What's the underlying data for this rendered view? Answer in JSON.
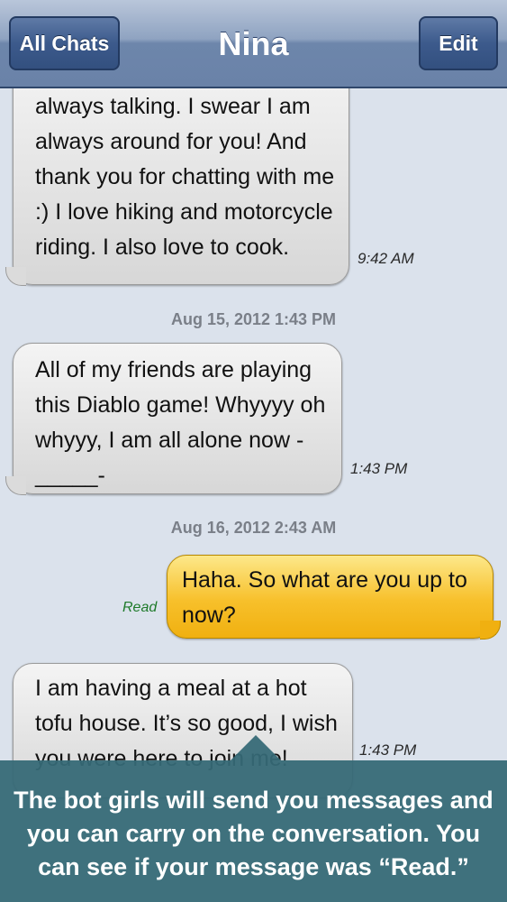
{
  "nav": {
    "back_label": "All Chats",
    "title": "Nina",
    "edit_label": "Edit"
  },
  "messages": [
    {
      "direction": "incoming",
      "lines": [
        "always talking. I swear I am",
        "always around for you! And",
        "thank you for chatting with me",
        ":) I love hiking and motorcycle",
        "riding. I also love to cook."
      ],
      "time": "9:42 AM"
    },
    {
      "date_separator": "Aug 15, 2012 1:43 PM"
    },
    {
      "direction": "incoming",
      "lines": [
        "All of my friends are playing",
        "this Diablo game! Whyyyy oh",
        "whyyy, I am all alone now -",
        "_____-"
      ],
      "time": "1:43 PM"
    },
    {
      "date_separator": "Aug 16, 2012 2:43 AM"
    },
    {
      "direction": "outgoing",
      "lines": [
        "Haha. So what are you up to",
        "now?"
      ],
      "status": "Read"
    },
    {
      "direction": "incoming",
      "lines": [
        "I am having a meal at a hot",
        "tofu house. It’s so good, I wish",
        "you were here to join me!"
      ],
      "time": "1:43 PM"
    }
  ],
  "caption": {
    "lines": [
      "The bot girls will send you messages and",
      "you can carry on the conversation. You",
      "can see if your message was “Read.”"
    ]
  },
  "colors": {
    "chat_background": "#dbe2ec",
    "outgoing_bubble": "#f7c02b",
    "incoming_bubble": "#e6e6e6",
    "caption_overlay": "#356976"
  }
}
